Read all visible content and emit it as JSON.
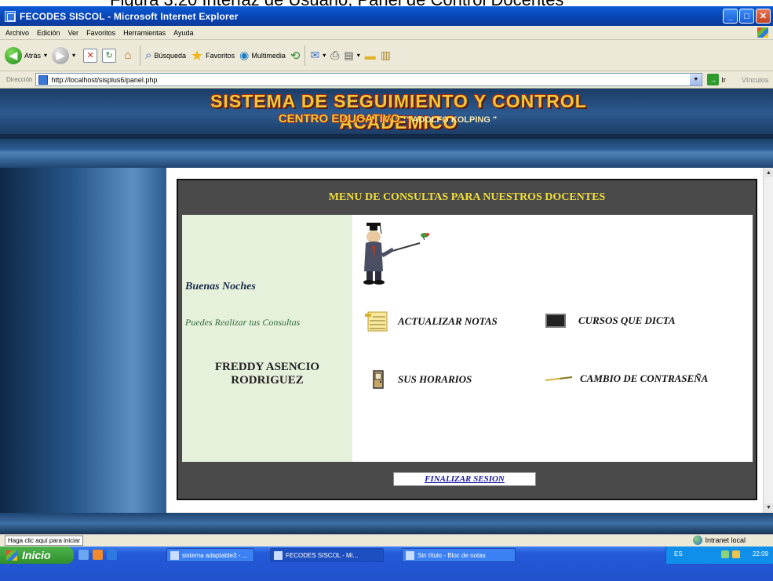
{
  "caption": "Figura 3.20 Interfaz de Usuario, Panel de Control Docentes",
  "window": {
    "title": "FECODES SISCOL - Microsoft Internet Explorer"
  },
  "menubar": [
    "Archivo",
    "Edición",
    "Ver",
    "Favoritos",
    "Herramientas",
    "Ayuda"
  ],
  "toolbar": {
    "back": "Atrás",
    "search": "Búsqueda",
    "favorites": "Favoritos",
    "multimedia": "Multimedia"
  },
  "addressbar": {
    "label": "Dirección",
    "url": "http://localhost/sisplus6/panel.php",
    "go": "Ir",
    "links": "Vínculos"
  },
  "header": {
    "title": "SISTEMA DE SEGUIMIENTO Y CONTROL ACADEMICO",
    "subtitle_main": "CENTRO EDUCATIVO",
    "subtitle_name": ":\" ADOLFO KOLPING \""
  },
  "panel": {
    "title": "MENU DE CONSULTAS PARA NUESTROS DOCENTES",
    "greeting": "Buenas Noches",
    "subtext": "Puedes Realizar tus Consultas",
    "user_line1": "FREDDY ASENCIO",
    "user_line2": "RODRIGUEZ",
    "options": {
      "update_grades": "ACTUALIZAR NOTAS",
      "courses": "CURSOS QUE DICTA",
      "schedules": "SUS HORARIOS",
      "password": "CAMBIO DE CONTRASEÑA"
    },
    "logout": "FINALIZAR SESION"
  },
  "statusbar": {
    "text": "Haga clic aquí para iniciar",
    "zone": "Intranet local"
  },
  "taskbar": {
    "start": "Inicio",
    "tasks": [
      "sistema adaptable3 - ...",
      "FECODES SISCOL - Mi...",
      "Sin título - Bloc de notas"
    ],
    "lang": "ES",
    "clock": "22:09"
  }
}
